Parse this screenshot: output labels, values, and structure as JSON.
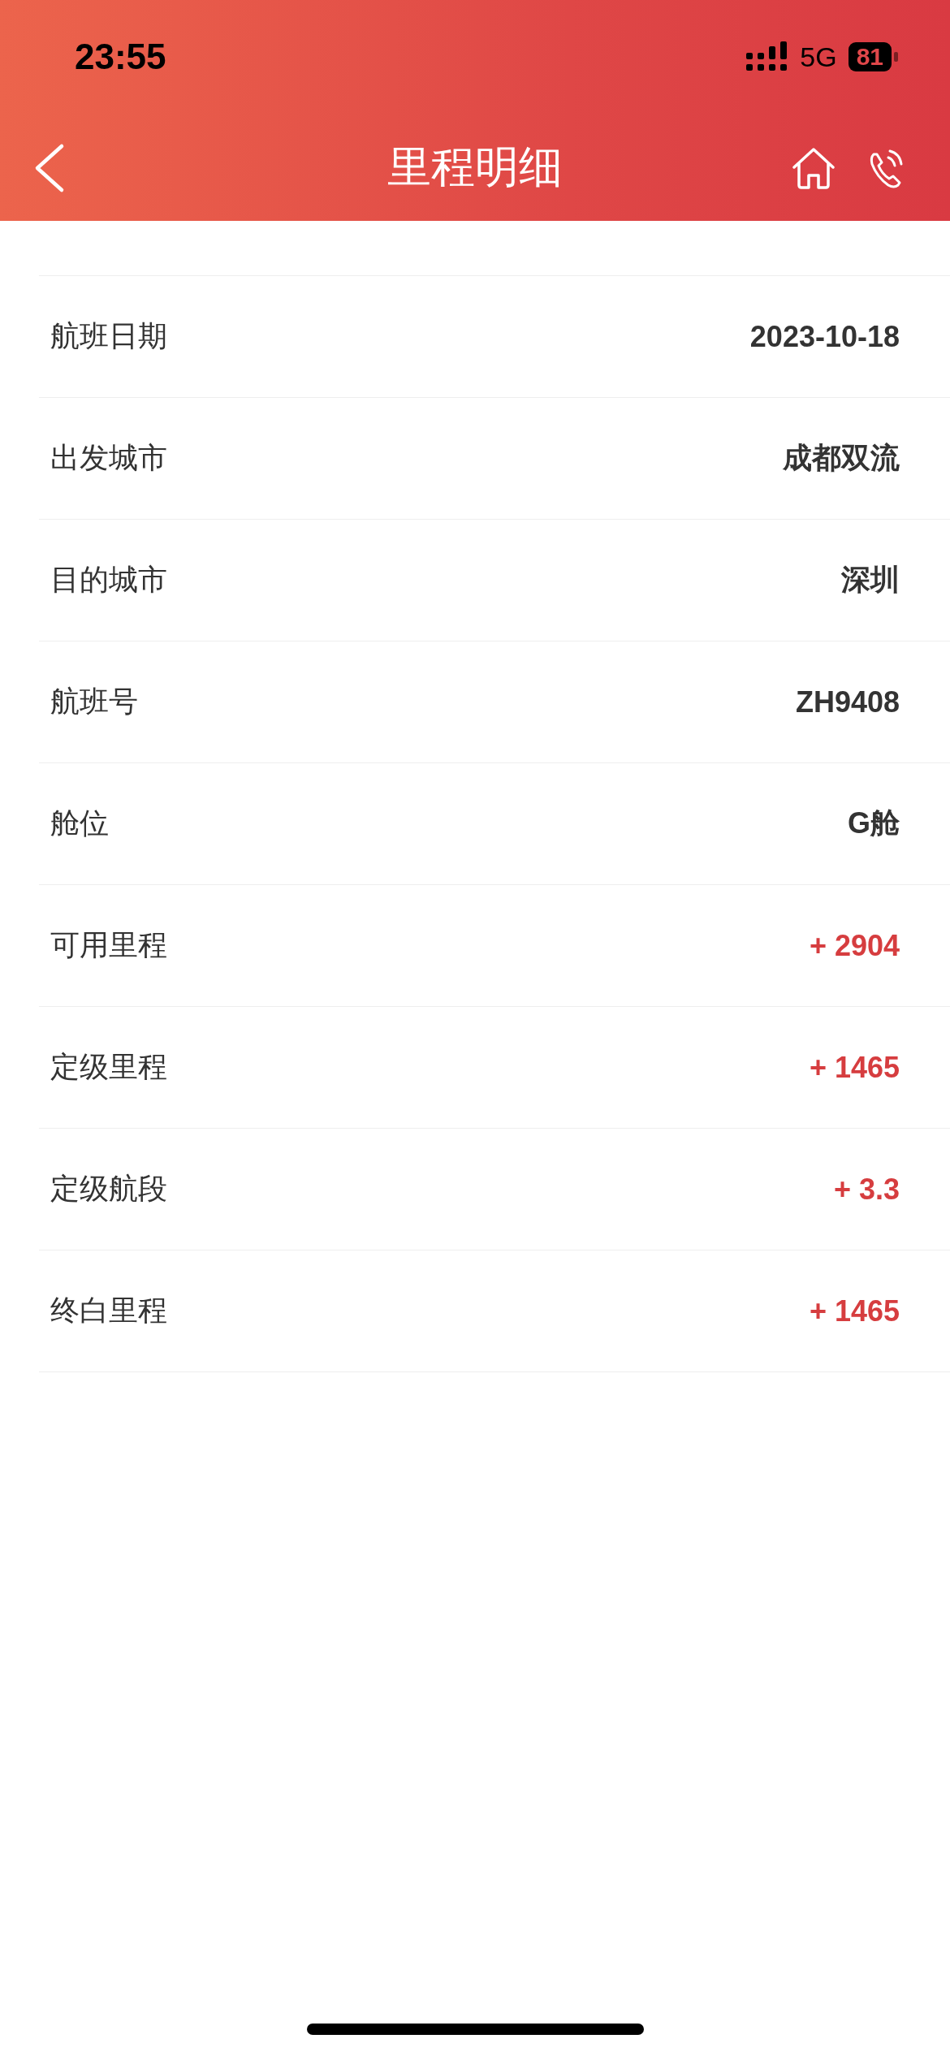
{
  "status_bar": {
    "time": "23:55",
    "network": "5G",
    "battery": "81"
  },
  "nav_bar": {
    "title": "里程明细"
  },
  "details": [
    {
      "label": "航班日期",
      "value": "2023-10-18",
      "kind": "plain"
    },
    {
      "label": "出发城市",
      "value": "成都双流",
      "kind": "plain"
    },
    {
      "label": "目的城市",
      "value": "深圳",
      "kind": "plain"
    },
    {
      "label": "航班号",
      "value": "ZH9408",
      "kind": "plain"
    },
    {
      "label": "舱位",
      "value": "G舱",
      "kind": "plain"
    },
    {
      "label": "可用里程",
      "value": "+ 2904",
      "kind": "earned"
    },
    {
      "label": "定级里程",
      "value": "+ 1465",
      "kind": "earned"
    },
    {
      "label": "定级航段",
      "value": "+ 3.3",
      "kind": "earned"
    },
    {
      "label": "终白里程",
      "value": "+ 1465",
      "kind": "earned"
    }
  ]
}
